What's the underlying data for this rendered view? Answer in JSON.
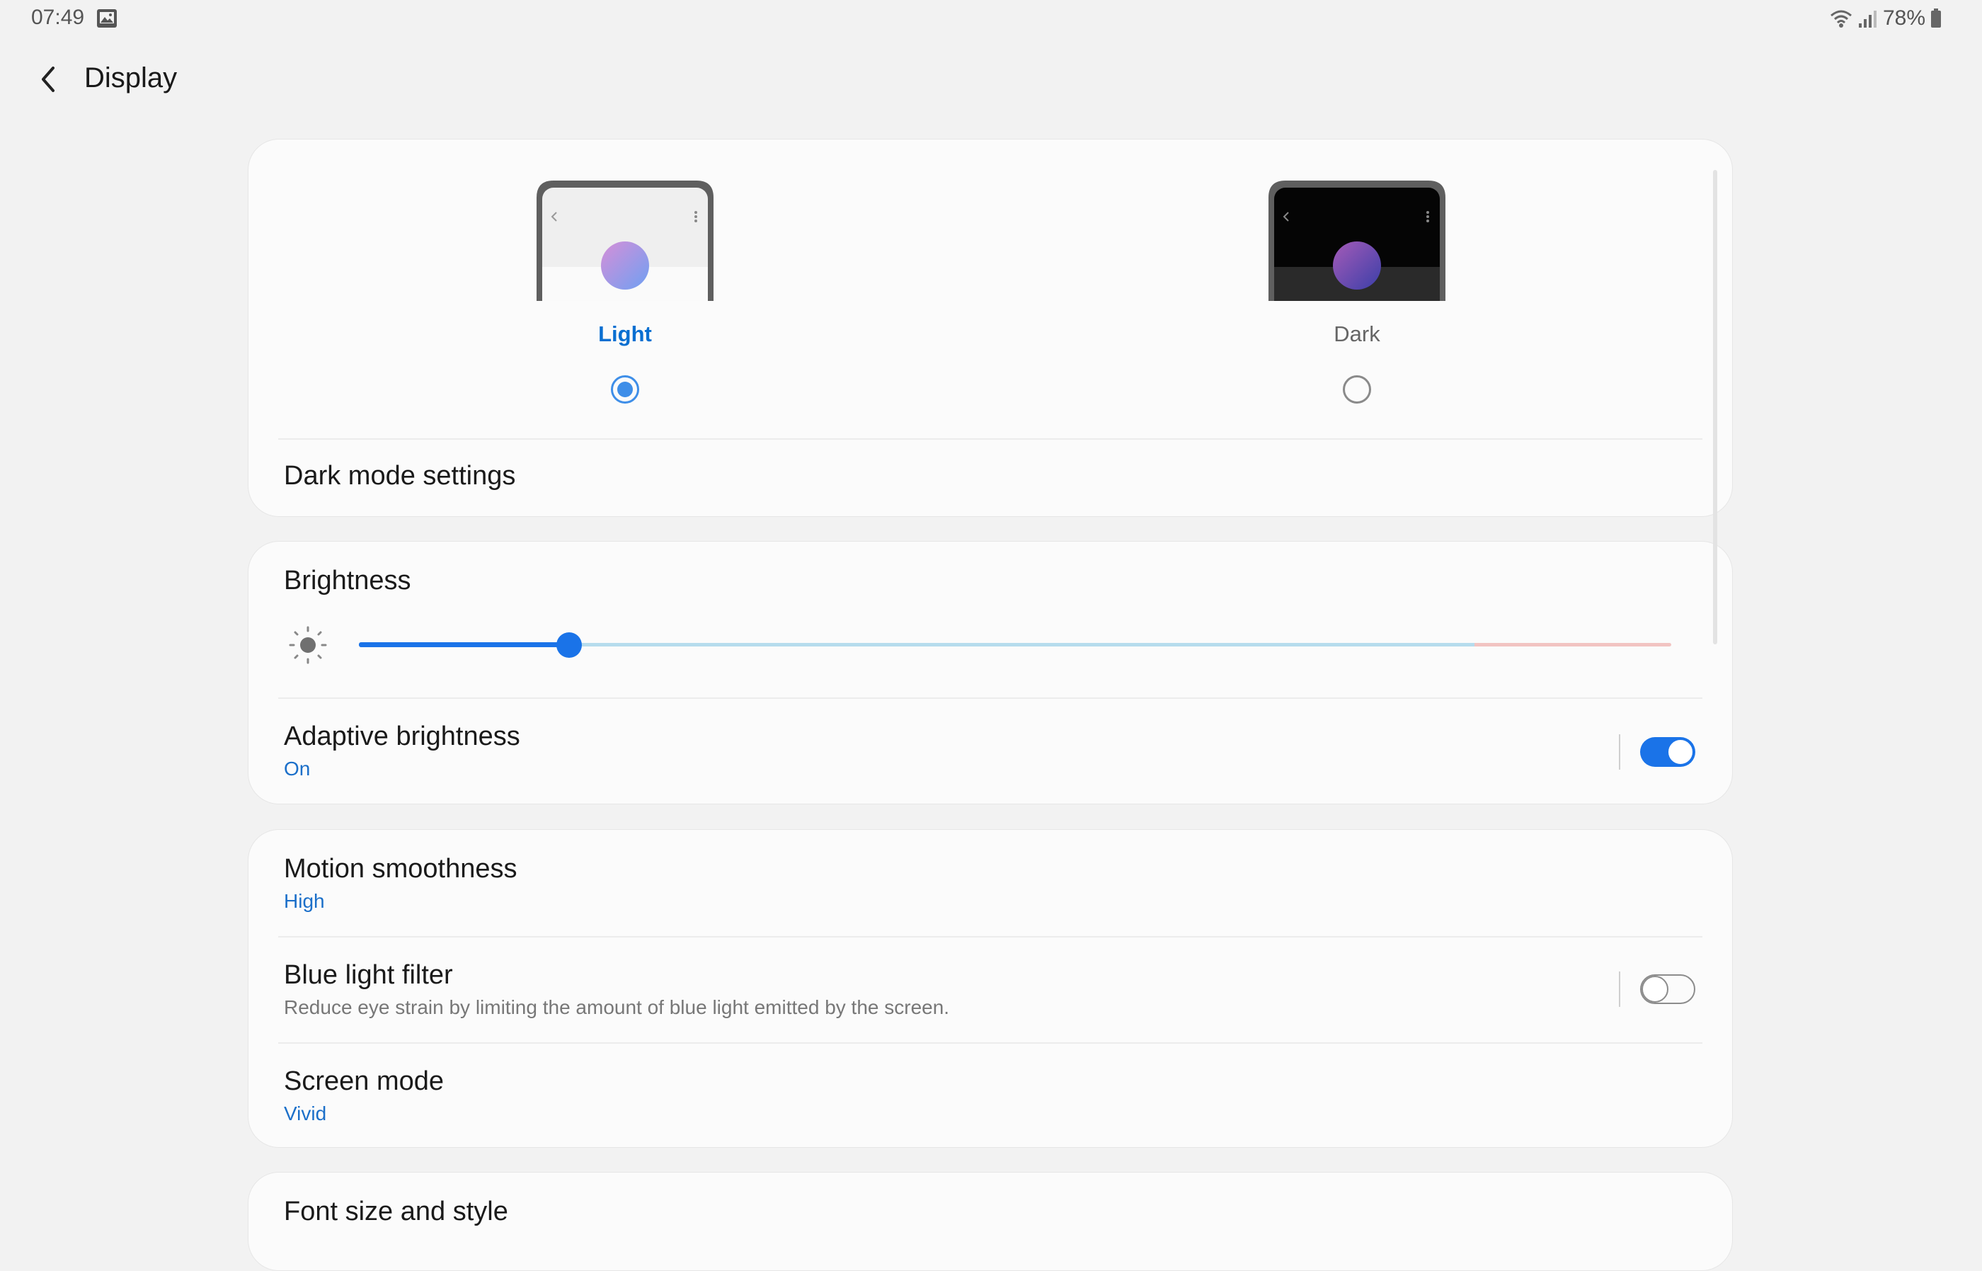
{
  "status_bar": {
    "time": "07:49",
    "battery": "78%"
  },
  "header": {
    "title": "Display"
  },
  "theme": {
    "options": [
      {
        "label": "Light",
        "selected": true
      },
      {
        "label": "Dark",
        "selected": false
      }
    ],
    "dark_mode_settings": "Dark mode settings"
  },
  "brightness": {
    "title": "Brightness",
    "level_fraction": 0.16
  },
  "adaptive_brightness": {
    "title": "Adaptive brightness",
    "status": "On",
    "enabled": true
  },
  "motion_smoothness": {
    "title": "Motion smoothness",
    "value": "High"
  },
  "blue_light_filter": {
    "title": "Blue light filter",
    "description": "Reduce eye strain by limiting the amount of blue light emitted by the screen.",
    "enabled": false
  },
  "screen_mode": {
    "title": "Screen mode",
    "value": "Vivid"
  },
  "font": {
    "title": "Font size and style"
  },
  "colors": {
    "accent": "#1a73e8",
    "selected_label": "#0a6fd1",
    "subtext_blue": "#1b6fc9"
  }
}
